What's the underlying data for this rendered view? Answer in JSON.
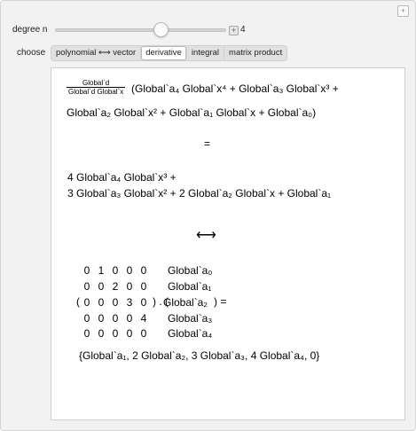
{
  "controls": {
    "degree_label": "degree n",
    "degree_value": "4",
    "degree_fraction": 0.62,
    "choose_label": "choose",
    "options": [
      {
        "label": "polynomial ⟷ vector",
        "active": false
      },
      {
        "label": "derivative",
        "active": true
      },
      {
        "label": "integral",
        "active": false
      },
      {
        "label": "matrix product",
        "active": false
      }
    ]
  },
  "output": {
    "deriv_num": "Global`d",
    "deriv_den": "Global`d Global`x",
    "poly_line1": "(Global`a₄ Global`x⁴ + Global`a₃ Global`x³ +",
    "poly_line2": "Global`a₂ Global`x² + Global`a₁ Global`x + Global`a₀)",
    "equals": "=",
    "result_line1": "4 Global`a₄ Global`x³ +",
    "result_line2": "3 Global`a₃ Global`x² + 2 Global`a₂ Global`x + Global`a₁",
    "arrow": "⟷",
    "matrix": [
      [
        "0",
        "1",
        "0",
        "0",
        "0"
      ],
      [
        "0",
        "0",
        "2",
        "0",
        "0"
      ],
      [
        "0",
        "0",
        "0",
        "3",
        "0"
      ],
      [
        "0",
        "0",
        "0",
        "0",
        "4"
      ],
      [
        "0",
        "0",
        "0",
        "0",
        "0"
      ]
    ],
    "vector": [
      "Global`a₀",
      "Global`a₁",
      "Global`a₂",
      "Global`a₃",
      "Global`a₄"
    ],
    "paren_open": "(",
    "product_mid": ") . (",
    "product_end": ") =",
    "result_list": "{Global`a₁, 2 Global`a₂, 3 Global`a₃, 4 Global`a₄, 0}"
  }
}
